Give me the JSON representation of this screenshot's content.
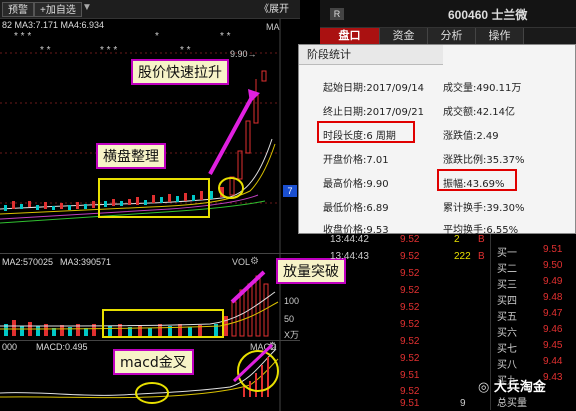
{
  "toolbar": {
    "alert_label": "预警",
    "add_fav_label": "+加自选",
    "expand_label": "《展开"
  },
  "chart": {
    "ma_line": "82  MA3:7.171  MA4:6.934",
    "ma_tag": "MA",
    "peak_label": "9.90→",
    "price_marker": "7",
    "vol_line_left": "MA2:570025",
    "vol_line_mid": "MA3:390571",
    "vol_tag": "VOL",
    "vol_axis_top": "160",
    "vol_axis_mid": "100",
    "vol_axis_bottom": "50",
    "vol_unit": "X万",
    "macd_line_left": "000",
    "macd_line": "MACD:0.495",
    "macd_tag": "MACD"
  },
  "annotations": {
    "price_rise": "股价快速拉升",
    "consolidation": "横盘整理",
    "volume_break": "放量突破",
    "macd_cross": "macd金叉"
  },
  "stock": {
    "badge": "R",
    "code_name": "600460 士兰微"
  },
  "tabs": [
    "盘口",
    "资金",
    "分析",
    "操作"
  ],
  "popup": {
    "title": "阶段统计",
    "rows": [
      {
        "left": "起始日期:2017/09/14",
        "right": "成交量:490.11万"
      },
      {
        "left": "终止日期:2017/09/21",
        "right": "成交额:42.14亿"
      },
      {
        "left": "时段长度:6 周期",
        "right": "涨跌值:2.49"
      },
      {
        "left": "开盘价格:7.01",
        "right": "涨跌比例:35.37%"
      },
      {
        "left": "最高价格:9.90",
        "right": "振幅:43.69%"
      },
      {
        "left": "最低价格:6.89",
        "right": "累计换手:39.30%"
      },
      {
        "left": "收盘价格:9.53",
        "right": "平均换手:6.55%"
      }
    ]
  },
  "ticks": [
    {
      "time": "13:44:42",
      "price": "9.52",
      "vol": "2",
      "side": "B"
    },
    {
      "time": "13:44:43",
      "price": "9.52",
      "vol": "222",
      "side": "B"
    },
    {
      "time": "",
      "price": "9.52",
      "vol": "",
      "side": ""
    },
    {
      "time": "",
      "price": "9.52",
      "vol": "",
      "side": ""
    },
    {
      "time": "",
      "price": "9.52",
      "vol": "",
      "side": ""
    },
    {
      "time": "",
      "price": "9.52",
      "vol": "",
      "side": ""
    },
    {
      "time": "",
      "price": "9.52",
      "vol": "",
      "side": ""
    },
    {
      "time": "",
      "price": "9.52",
      "vol": "",
      "side": ""
    },
    {
      "time": "",
      "price": "9.51",
      "vol": "",
      "side": ""
    },
    {
      "time": "",
      "price": "9.52",
      "vol": "",
      "side": ""
    },
    {
      "time": "",
      "price": "9.51",
      "vol": "",
      "side": ""
    },
    {
      "time": "",
      "price": "9.51",
      "vol": "9",
      "side": ""
    }
  ],
  "book": {
    "rows": [
      {
        "label": "买一",
        "price": "9.51"
      },
      {
        "label": "买二",
        "price": "9.50"
      },
      {
        "label": "买三",
        "price": "9.49"
      },
      {
        "label": "买四",
        "price": "9.48"
      },
      {
        "label": "买五",
        "price": "9.47"
      },
      {
        "label": "买六",
        "price": "9.46"
      },
      {
        "label": "买七",
        "price": "9.45"
      },
      {
        "label": "买八",
        "price": "9.44"
      },
      {
        "label": "买九",
        "price": "9.43"
      },
      {
        "label": "总买量",
        "price": ""
      }
    ]
  },
  "watermark": "大兵淘金",
  "colors": {
    "up": "#e03030",
    "down": "#00c8c8",
    "highlight_box": "#e8e000",
    "annotation_border": "#c000c0",
    "popup_box": "#e00000"
  }
}
